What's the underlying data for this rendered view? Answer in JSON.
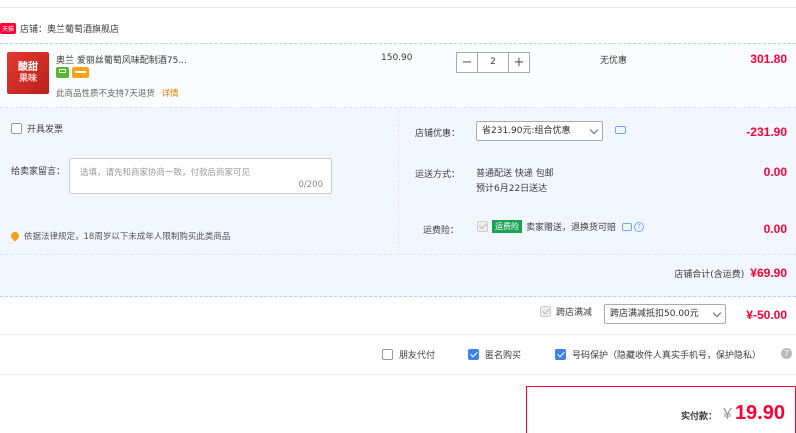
{
  "shop": {
    "badge": "天猫",
    "name": "店铺：奥兰葡萄酒旗舰店"
  },
  "item": {
    "title": "奥兰 爱丽丝葡萄风味配制酒75...",
    "unit_price": "150.90",
    "quantity": "2",
    "discount": "无优惠",
    "subtotal": "301.80",
    "return_note": "此商品性质不支持7天退货",
    "return_link": "详情",
    "thumb_text_1": "酸甜",
    "thumb_text_2": "果味"
  },
  "invoice": {
    "label": "开具发票"
  },
  "message": {
    "label": "给卖家留言：",
    "placeholder": "选填，请先和商家协商一致，付款后商家可见",
    "counter": "0/200"
  },
  "legal_note": "依据法律规定，18周岁以下未成年人限制购买此类商品",
  "shop_discount": {
    "label": "店铺优惠：",
    "selected": "省231.90元:组合优惠",
    "amount": "-231.90"
  },
  "shipping": {
    "label": "运送方式：",
    "method": "普通配送 快递 包邮",
    "eta": "预计6月22日送达",
    "amount": "0.00"
  },
  "insurance": {
    "label": "运费险：",
    "tag": "运费险",
    "desc": "卖家赠送，退换货可赔",
    "amount": "0.00"
  },
  "shop_total": {
    "label": "店铺合计(含运费)",
    "amount": "¥69.90"
  },
  "cross_store": {
    "label": "跨店满减",
    "selected": "跨店满减抵扣50.00元",
    "amount": "¥-50.00"
  },
  "options": {
    "friend_pay": "朋友代付",
    "anonymous": "匿名购买",
    "number_protect": "号码保护（隐藏收件人真实手机号，保护隐私）",
    "help": "?"
  },
  "payment": {
    "label": "实付款：",
    "currency": "¥",
    "amount": "19.90"
  },
  "colors": {
    "accent_red": "#ff0036",
    "panel_blue": "#f2f7ff",
    "border_blue": "#b2d1ff",
    "check_blue": "#3d82e8"
  }
}
